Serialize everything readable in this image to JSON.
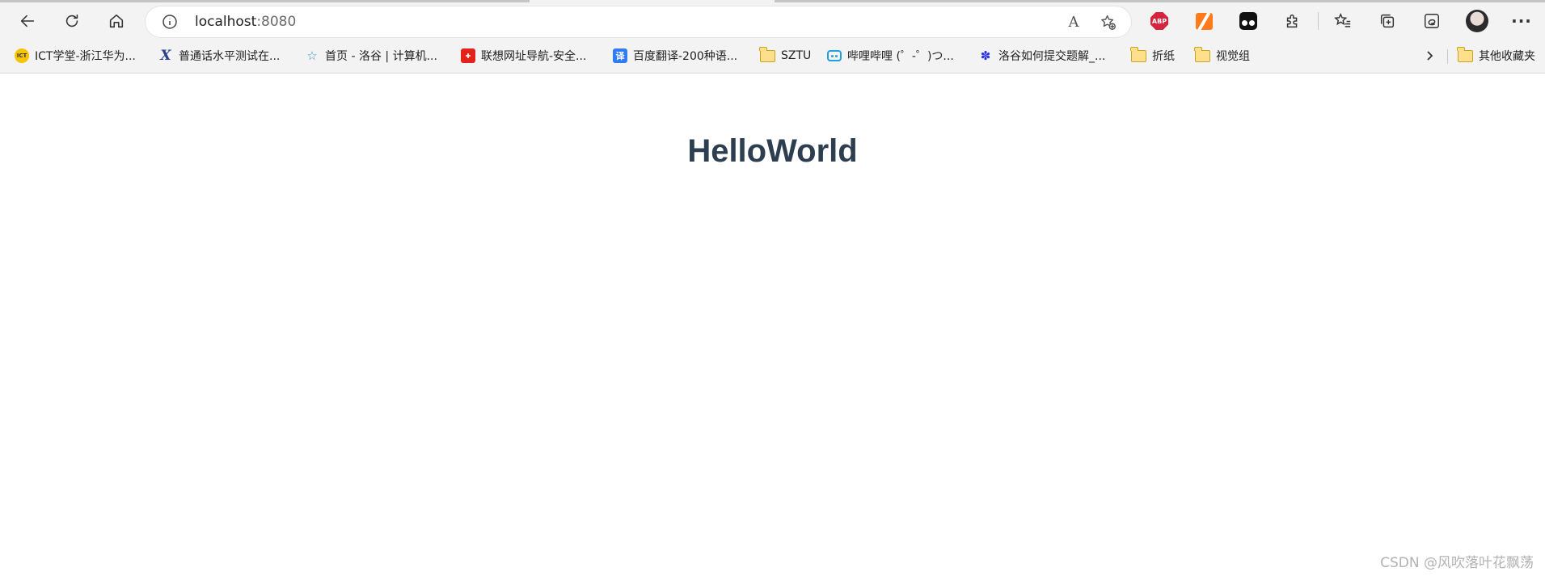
{
  "browser": {
    "address_bar": {
      "host": "localhost",
      "port": ":8080"
    },
    "read_aloud_label": "A",
    "extensions": {
      "adblock_label": "ABP"
    },
    "menu_label": "···"
  },
  "bookmarks": [
    {
      "label": "ICT学堂-浙江华为...",
      "icon": "ict-icon",
      "icon_text": "ICT"
    },
    {
      "label": "普通话水平测试在...",
      "icon": "x-logo-icon",
      "icon_text": "X"
    },
    {
      "label": "首页 - 洛谷 | 计算机...",
      "icon": "luogu-icon",
      "icon_text": ""
    },
    {
      "label": "联想网址导航-安全...",
      "icon": "lenovo-icon",
      "icon_text": ""
    },
    {
      "label": "百度翻译-200种语...",
      "icon": "baidu-translate-icon",
      "icon_text": "译"
    },
    {
      "label": "SZTU",
      "icon": "folder-icon",
      "icon_text": ""
    },
    {
      "label": "哔哩哔哩 (゜-゜)つ...",
      "icon": "bilibili-icon",
      "icon_text": ""
    },
    {
      "label": "洛谷如何提交题解_...",
      "icon": "baidu-paw-icon",
      "icon_text": ""
    },
    {
      "label": "折纸",
      "icon": "folder-icon",
      "icon_text": ""
    },
    {
      "label": "视觉组",
      "icon": "folder-icon",
      "icon_text": ""
    }
  ],
  "other_bookmarks": {
    "label": "其他收藏夹",
    "icon": "folder-icon"
  },
  "page": {
    "heading": "HelloWorld"
  },
  "watermark": "CSDN @风吹落叶花飘荡"
}
